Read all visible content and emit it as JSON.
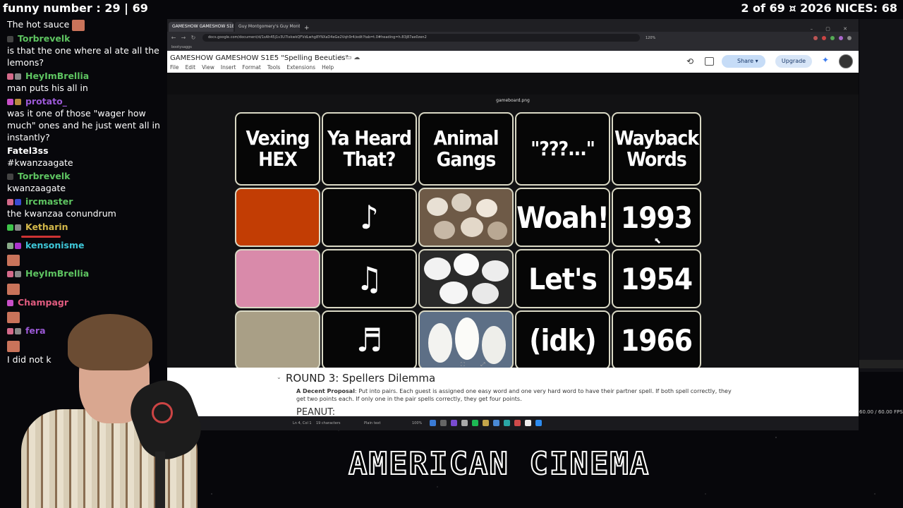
{
  "overlay": {
    "top_left": "funny number : 29 | 69",
    "top_right": "2 of 69  ¤  2026 NICES: 68",
    "brand_text": "AMERICAN CINEMA",
    "fps": "60.00 / 60.00 FPS"
  },
  "chat": [
    {
      "user": "",
      "text": "The hot sauce",
      "color": "#ffffff"
    },
    {
      "user": "Torbrevelk",
      "text": "is that the one where al ate all the lemons?",
      "color": "#5ec461"
    },
    {
      "user": "HeyImBrellia",
      "text": "man puts his all in",
      "color": "#5ec461"
    },
    {
      "user": "protato_",
      "text": "was it one of those \"wager how much\" ones and he just went all in instantly?",
      "color": "#9b59d6"
    },
    {
      "user": "Fatel3ss",
      "text": "#kwanzaagate",
      "color": "#ffffff"
    },
    {
      "user": "Torbrevelk",
      "text": "kwanzaagate",
      "color": "#5ec461"
    },
    {
      "user": "ircmaster",
      "text": "the kwanzaa conundrum",
      "color": "#5ec461"
    },
    {
      "user": "Ketharin",
      "text": "",
      "color": "#d4b84a"
    },
    {
      "user": "kensonisme",
      "text": "",
      "color": "#3ec7d8"
    },
    {
      "user": "HeyImBrellia",
      "text": "",
      "color": "#5ec461"
    },
    {
      "user": "Champagr",
      "text": "",
      "color": "#e05b7f"
    },
    {
      "user": "fera",
      "text": "",
      "color": "#9b59d6"
    },
    {
      "user": "",
      "text": "I did not k",
      "color": "#ffffff"
    }
  ],
  "browser": {
    "tabs": [
      "GAMESHOW GAMESHOW S1E5",
      "Guy Montgomery's Guy Mont-S"
    ],
    "url": "docs.google.com/document/d/1sAh45j1v3U7lxkwkQFVdLwhg8YNXaD4eGe2Vqh9r4/edit?tab=t.0#heading=h.83j87ae0zen2",
    "zoom": "120%",
    "bookmarks": "bootysaggs"
  },
  "doc": {
    "title": "GAMESHOW GAMESHOW S1E5 \"Spelling Beeuties\"",
    "menu": [
      "File",
      "Edit",
      "View",
      "Insert",
      "Format",
      "Tools",
      "Extensions",
      "Help"
    ],
    "share_label": "Share",
    "upgrade_label": "Upgrade",
    "image_name": "gameboard.png",
    "round_heading": "ROUND 3: Spellers Dilemma",
    "proposal_label": "A Decent Proposal",
    "proposal_text": ": Put into pairs. Each guest is assigned one easy word and one very hard word to have their partner spell. If both spell correctly, they get two points each. If only one in the pair spells correctly, they get four points.",
    "next_heading": "PEANUT:"
  },
  "board": {
    "headers": [
      "Vexing HEX",
      "Ya Heard That?",
      "Animal Gangs",
      "\"???...\"",
      "Wayback Words"
    ],
    "hex_colors": [
      "#c23d04",
      "#d98aaa",
      "#a99f86"
    ],
    "notes": [
      "♪",
      "♫",
      "♬"
    ],
    "animals": [
      "ferrets",
      "pandas",
      "snowy owls"
    ],
    "phrases": [
      "Woah!",
      "Let's",
      "(idk)"
    ],
    "years": [
      "1993",
      "1954",
      "1966"
    ]
  },
  "taskbar": {
    "position": "Ln 4, Col 1",
    "chars": "19 characters",
    "mode": "Plain text",
    "zoom": "100%"
  }
}
